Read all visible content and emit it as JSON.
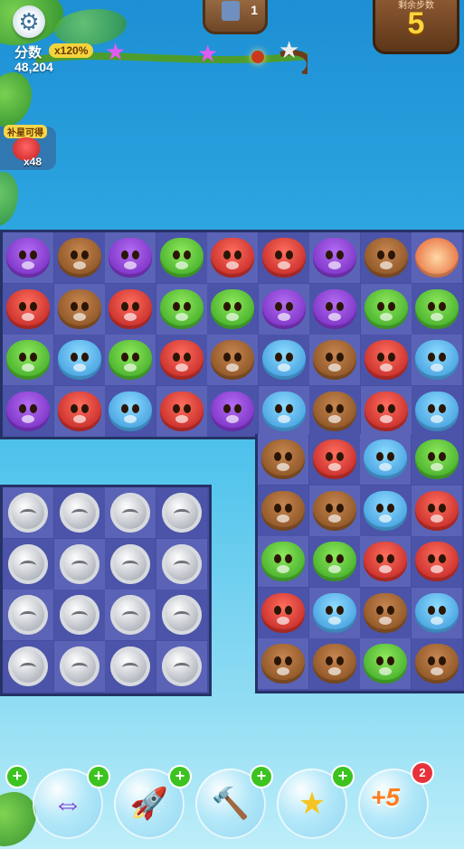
{
  "hud": {
    "score_label": "分数",
    "score_value": "48,204",
    "multiplier": "x120%",
    "moves_label": "剩余步数",
    "moves_value": "5",
    "top_booster_count": "1",
    "stars_filled": 2,
    "stars_total": 3
  },
  "bonus": {
    "tag": "补星可得",
    "count": "x48"
  },
  "colors": {
    "owl": "#8a3fd6",
    "bear": "#a0632f",
    "frog": "#55c83a",
    "fox": "#dd2b2b",
    "hippo": "#4bb3ec",
    "board": "#454ea3"
  },
  "board_main": [
    [
      "owl",
      "bear",
      "owl",
      "frog",
      "fox",
      "fox",
      "owl",
      "bear",
      "rocket"
    ],
    [
      "fox",
      "bear",
      "fox",
      "frog",
      "frog",
      "owl",
      "owl",
      "frog",
      "frog"
    ],
    [
      "frog",
      "hippo",
      "frog",
      "fox",
      "bear",
      "hippo",
      "bear",
      "fox",
      "hippo"
    ],
    [
      "owl",
      "fox",
      "hippo",
      "fox",
      "owl",
      "hippo",
      "bear",
      "fox",
      "hippo"
    ]
  ],
  "board_right": [
    [
      "bear",
      "fox",
      "hippo",
      "frog"
    ],
    [
      "bear",
      "bear",
      "hippo",
      "fox"
    ],
    [
      "frog",
      "frog",
      "fox",
      "fox"
    ],
    [
      "fox",
      "hippo",
      "bear",
      "hippo"
    ],
    [
      "bear",
      "bear",
      "frog",
      "bear"
    ]
  ],
  "board_coins": [
    [
      "coin",
      "coin",
      "coin",
      "coin"
    ],
    [
      "coin",
      "coin",
      "coin",
      "coin"
    ],
    [
      "coin",
      "coin",
      "coin",
      "coin"
    ],
    [
      "coin",
      "coin",
      "coin",
      "coin"
    ]
  ],
  "boosters": [
    {
      "name": "swap-fish",
      "icon": "⇔"
    },
    {
      "name": "rocket",
      "icon": "🚀"
    },
    {
      "name": "hammer",
      "icon": "🔨"
    },
    {
      "name": "magic-star",
      "icon": "★"
    },
    {
      "name": "extra-moves",
      "label": "+5",
      "badge": "2"
    }
  ]
}
